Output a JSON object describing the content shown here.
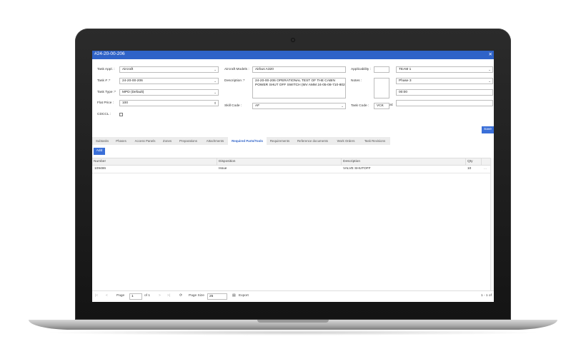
{
  "window": {
    "title": "#24-20-00-206",
    "close_icon": "close-icon"
  },
  "form": {
    "task_appl": {
      "label": "Task Appl. :",
      "value": "Aircraft"
    },
    "task_no": {
      "label": "Task # :*",
      "value": "24-20-00-206"
    },
    "task_type": {
      "label": "Task Type :*",
      "value": "MPD (Default)"
    },
    "flat_price": {
      "label": "Flat Price :",
      "value": "100"
    },
    "cdccl": {
      "label": "CDCCL :",
      "checked": false
    },
    "aircraft_models": {
      "label": "Aircraft Models :",
      "value": "Airbus A320"
    },
    "description": {
      "label": "Description :*",
      "value": "24-20-00-206 OPERATIONAL TEST OF THE CABIN POWER SHUT OFF SWITCH (MV AMM 24-05-08-710-802"
    },
    "skill_code": {
      "label": "Skill Code :",
      "value": "AF"
    },
    "applicability": {
      "label": "Applicability :",
      "value": ""
    },
    "notes": {
      "label": "Notes :",
      "value": ""
    },
    "task_code": {
      "label": "Task Code :",
      "value": "VCK",
      "extra": "at:"
    },
    "team": {
      "value": "TEAM 1"
    },
    "phase": {
      "value": "Phase 3"
    },
    "time": {
      "value": "00:00"
    }
  },
  "buttons": {
    "save": "Save",
    "add": "Add"
  },
  "tabs": [
    "Subtasks",
    "Phases",
    "Access Panels",
    "Zones",
    "Preparations",
    "Attachments",
    "Required Parts/Tools",
    "Requirements",
    "Reference documents",
    "Work Orders",
    "Task Revisions"
  ],
  "active_tab": "Required Parts/Tools",
  "grid": {
    "columns": [
      "Number",
      "Disposition",
      "Description",
      "Qty"
    ],
    "rows": [
      {
        "number": "109486",
        "disposition": "Issue",
        "description": "VALVE SHUTOFF",
        "qty": "10",
        "more": "..."
      }
    ]
  },
  "pager": {
    "page_label": "Page",
    "page": "1",
    "of": "of 1",
    "page_size_label": "Page Size",
    "page_size": "25",
    "export": "Export",
    "range": "1 - 1 of"
  }
}
